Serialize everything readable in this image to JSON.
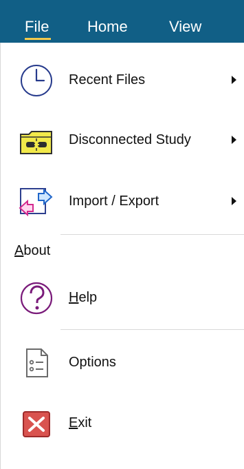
{
  "tabs": [
    {
      "label": "File"
    },
    {
      "label": "Home"
    },
    {
      "label": "View"
    }
  ],
  "menu": {
    "items": {
      "recent_files": {
        "label": "Recent Files",
        "icon": "clock-icon"
      },
      "disconnected_study": {
        "label": "Disconnected Study",
        "icon": "disconnected-study-icon"
      },
      "import_export": {
        "label": "Import / Export",
        "icon": "import-export-icon"
      }
    },
    "about": {
      "title_first": "A",
      "title_rest": "bout",
      "help": {
        "label_first": "H",
        "label_rest": "elp",
        "icon": "help-icon"
      },
      "options": {
        "label": "Options",
        "icon": "options-icon"
      },
      "exit": {
        "label_first": "E",
        "label_rest": "xit",
        "icon": "exit-icon"
      }
    }
  },
  "colors": {
    "ribbon": "#115f86",
    "tab_underline": "#f2c94c",
    "help": "#7a1b7a",
    "exit": "#d9534f"
  }
}
